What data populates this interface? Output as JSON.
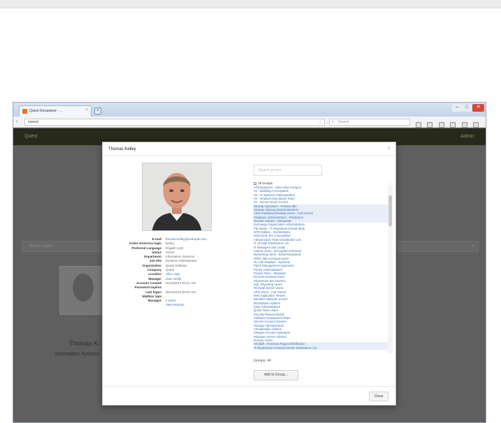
{
  "browser": {
    "tab_title": "Quest Groupwise - ...",
    "tab_close": "×",
    "new_tab": "+",
    "url": "/users/",
    "url_go": "→",
    "search_placeholder": "Search",
    "search_icon": "magnifier-icon",
    "window_minimize": "–",
    "window_maximize": "□",
    "window_close": "✕",
    "nav_back": "‹"
  },
  "app": {
    "brand": "Quest",
    "user_menu": "Admin",
    "filter_placeholder": "Select users",
    "filter_caret": "▾",
    "background_card_name": "Thomas K.",
    "background_card_subtitle": "Information Systems"
  },
  "modal": {
    "title": "Thomas Kelley",
    "close_icon": "×",
    "fields": [
      {
        "label": "E-mail",
        "value": "thomas.kelley@example.com",
        "link": true
      },
      {
        "label": "Active Directory login",
        "value": "tkelley",
        "link": false
      },
      {
        "label": "Preferred Language",
        "value": "English (US)",
        "link": false
      },
      {
        "label": "Status",
        "value": "Active",
        "link": false
      },
      {
        "label": "Department",
        "value": "Information Systems",
        "link": false
      },
      {
        "label": "Job title",
        "value": "Systems Administrator",
        "link": false
      },
      {
        "label": "Organization",
        "value": "Quest Software",
        "link": false
      },
      {
        "label": "Company",
        "value": "Quest",
        "link": false
      },
      {
        "label": "Location",
        "value": "Aliso Viejo",
        "link": true
      },
      {
        "label": "Manager",
        "value": "Jane Smith",
        "link": true
      },
      {
        "label": "Account Created",
        "value": "01/15/2013 09:21 AM",
        "link": false
      },
      {
        "label": "Password expires",
        "value": "",
        "link": false
      },
      {
        "label": "Last logon",
        "value": "06/10/2013 08:02 AM",
        "link": false
      },
      {
        "label": "Mailbox type",
        "value": "",
        "link": false
      },
      {
        "label": "Manages",
        "value": "2 users",
        "link": true
      },
      {
        "label": "",
        "value": "View Reports",
        "link": true
      }
    ],
    "group_search_placeholder": "Search groups",
    "groups_header": "All Groups",
    "groups": [
      "All Employees - Aliso Viejo Campus",
      "AV - Building A Occupants",
      "AV - IT Systems Administrators",
      "AV - Network Operations Team",
      "AV - Server Room Access",
      "Backup Operators - Primary Site",
      "Change Advisory Board Members",
      "Citrix Published Desktop Users - Full Access",
      "Database Administrators - Production",
      "Domain Admins - Delegated",
      "Exchange Organization Administrators",
      "File Share - IT Department Read Write",
      "GPO Editors - Workstations",
      "Help Desk Tier 2 Escalation",
      "Infrastructure Team Distribution List",
      "IT All Staff Distribution List",
      "IT Managers and Leads",
      "Laptop Users - Encryption Enforced",
      "Monitoring Alerts - Email Recipients",
      "Office 365 Licensed Users",
      "On Call Rotation - Systems",
      "Patch Management Approvers",
      "Printer Administrators",
      "Project Team - Migration",
      "Remote Desktop Users",
      "SharePoint Site Owners",
      "SQL Reporting Users",
      "Terminal Server Users",
      "VPN Users - Full Tunnel",
      "Web Application Testers",
      "Wireless Network Access",
      "Workstation Admins",
      "Zone Administrators",
      "Quest Tools Users",
      "Security Review Board",
      "Software Deployment Team",
      "Service Account Owners",
      "Storage Administrators",
      "Virtualization Admins",
      "VMware vCenter Operators",
      "Windows Server Admins",
      "Domain Users",
      "All Staff - Americas Region Distribution",
      "IT Department Announcements Distribution List"
    ],
    "groups_footer": "Groups: 44",
    "add_group_button": "Add to Group...",
    "close_button": "Close"
  },
  "colors": {
    "app_header": "#27291a",
    "link": "#3a6fb0",
    "overlay": "#5f5f5f"
  }
}
